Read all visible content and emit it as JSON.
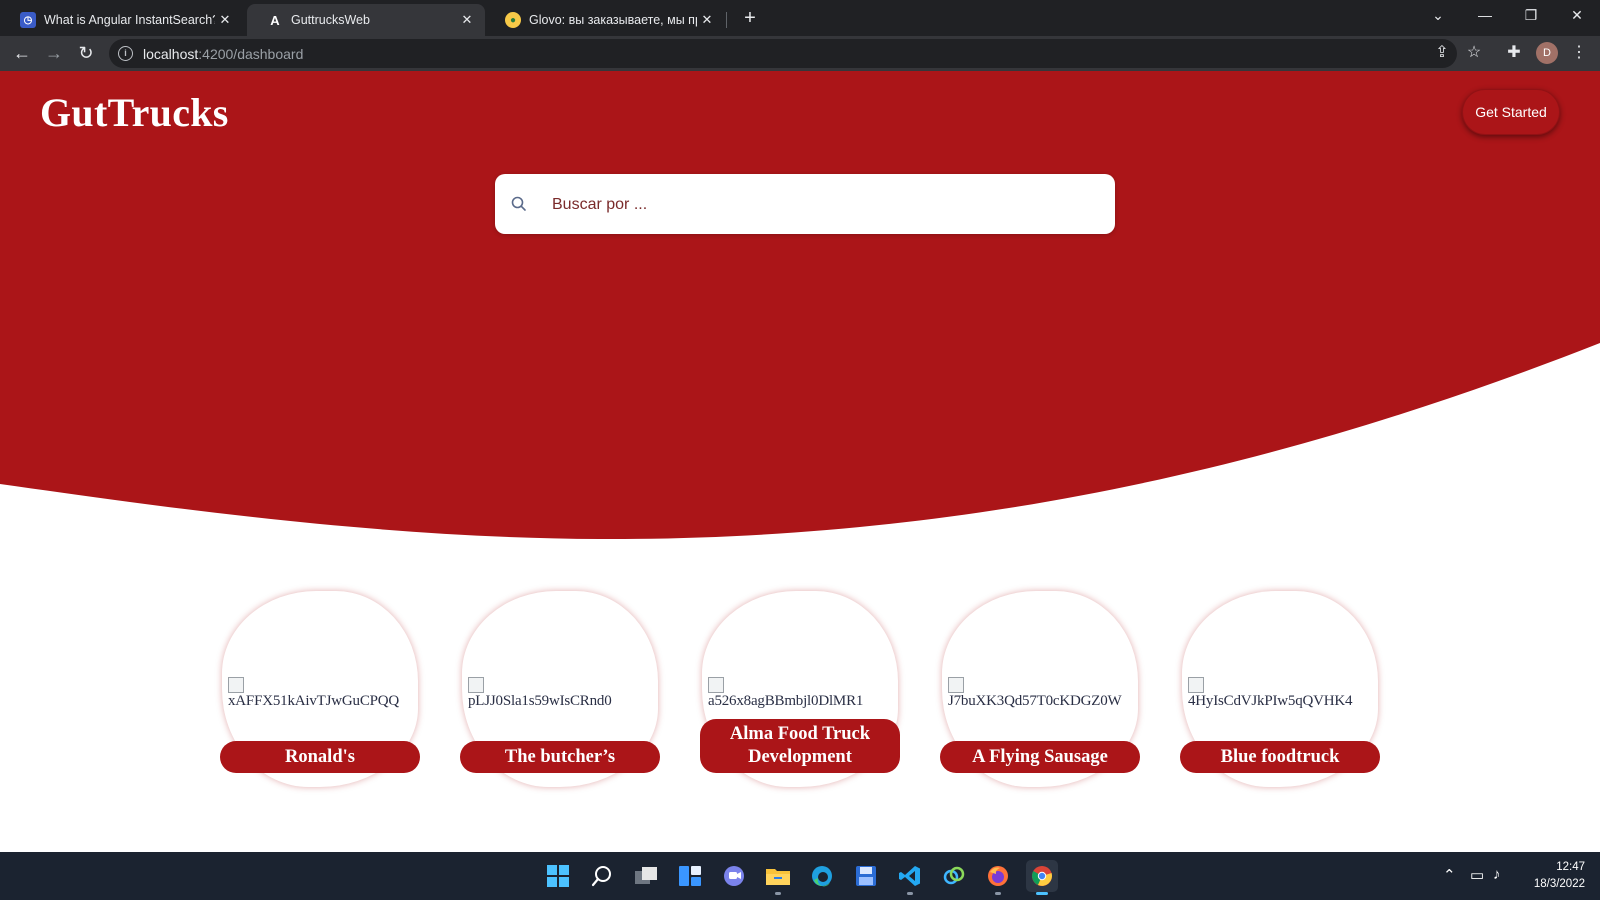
{
  "browser": {
    "tabs": [
      {
        "title": "What is Angular InstantSearch? |",
        "active": false
      },
      {
        "title": "GuttrucksWeb",
        "active": true
      },
      {
        "title": "Glovo: вы заказываете, мы прие",
        "active": false
      }
    ],
    "url_host": "localhost",
    "url_path": ":4200/dashboard",
    "profile_initial": "D"
  },
  "header": {
    "brand": "GutTrucks",
    "cta_label": "Get Started"
  },
  "search": {
    "placeholder": "Buscar por ..."
  },
  "colors": {
    "brand_red": "#ab1518",
    "chrome_dark": "#202124",
    "taskbar": "#1b2330"
  },
  "trucks": [
    {
      "image_alt": "xAFFX51kAivTJwGuCPQQ",
      "name": "Ronald's"
    },
    {
      "image_alt": "pLJJ0Sla1s59wIsCRnd0",
      "name": "The butcher’s"
    },
    {
      "image_alt": "a526x8agBBmbjl0DlMR1",
      "name": "Alma Food Truck Development"
    },
    {
      "image_alt": "J7buXK3Qd57T0cKDGZ0W",
      "name": "A Flying Sausage"
    },
    {
      "image_alt": "4HyIsCdVJkPIw5qQVHK4",
      "name": "Blue foodtruck"
    }
  ],
  "taskbar": {
    "time": "12:47",
    "date": "18/3/2022",
    "apps": [
      "start-icon",
      "search-icon",
      "task-view-icon",
      "widgets-icon",
      "chat-icon",
      "file-explorer-icon",
      "edge-icon",
      "save-app-icon",
      "vscode-icon",
      "app-icon",
      "firefox-icon",
      "chrome-icon"
    ]
  }
}
